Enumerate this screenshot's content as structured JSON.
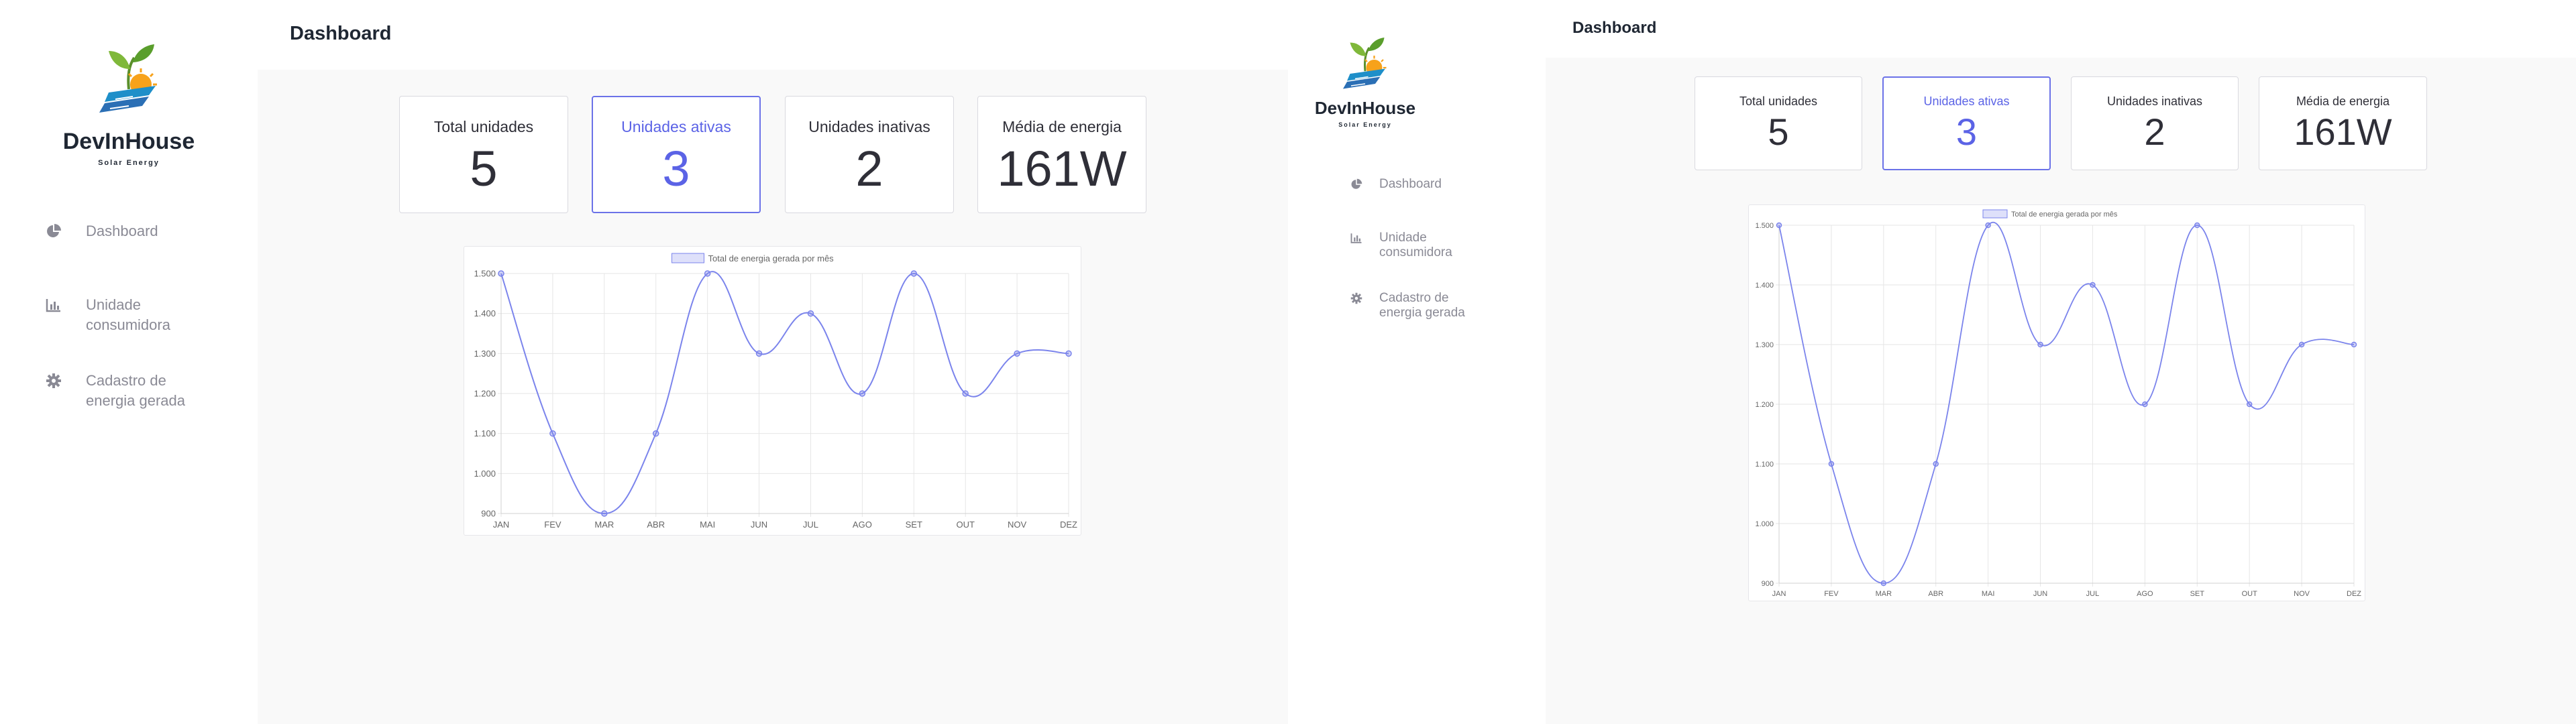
{
  "app": {
    "brand_name": "DevInHouse",
    "brand_subtitle": "Solar Energy"
  },
  "sidebar": {
    "items": [
      {
        "label": "Dashboard",
        "icon": "pie-chart-icon"
      },
      {
        "label": "Unidade consumidora",
        "icon": "bar-chart-icon"
      },
      {
        "label": "Cadastro de energia gerada",
        "icon": "gear-icon"
      }
    ]
  },
  "sidebar_right": {
    "items": [
      {
        "label": "Dashboard",
        "icon": "pie-chart-icon"
      },
      {
        "label": "Unidade consumidora",
        "icon": "bar-chart-icon"
      },
      {
        "label": "Cadastro de energia gerada",
        "icon": "gear-icon"
      }
    ]
  },
  "header": {
    "title": "Dashboard"
  },
  "cards": [
    {
      "label": "Total unidades",
      "value": "5"
    },
    {
      "label": "Unidades ativas",
      "value": "3"
    },
    {
      "label": "Unidades inativas",
      "value": "2"
    },
    {
      "label": "Média de energia",
      "value": "161W"
    }
  ],
  "colors": {
    "accent": "#5b63e6",
    "line": "#7b84ec",
    "sidebar_text": "#8a8a95",
    "main_bg": "#f9f9f9"
  },
  "chart_data": {
    "type": "line",
    "categories": [
      "JAN",
      "FEV",
      "MAR",
      "ABR",
      "MAI",
      "JUN",
      "JUL",
      "AGO",
      "SET",
      "OUT",
      "NOV",
      "DEZ"
    ],
    "series": [
      {
        "name": "Total de energia gerada por mês",
        "values": [
          1500,
          1100,
          900,
          1100,
          1500,
          1300,
          1400,
          1200,
          1500,
          1200,
          1300,
          1300
        ]
      }
    ],
    "y_ticks": [
      "900",
      "1.000",
      "1.100",
      "1.200",
      "1.300",
      "1.400",
      "1.500"
    ],
    "ylim": [
      900,
      1500
    ],
    "legend": "top-center",
    "grid": true
  }
}
